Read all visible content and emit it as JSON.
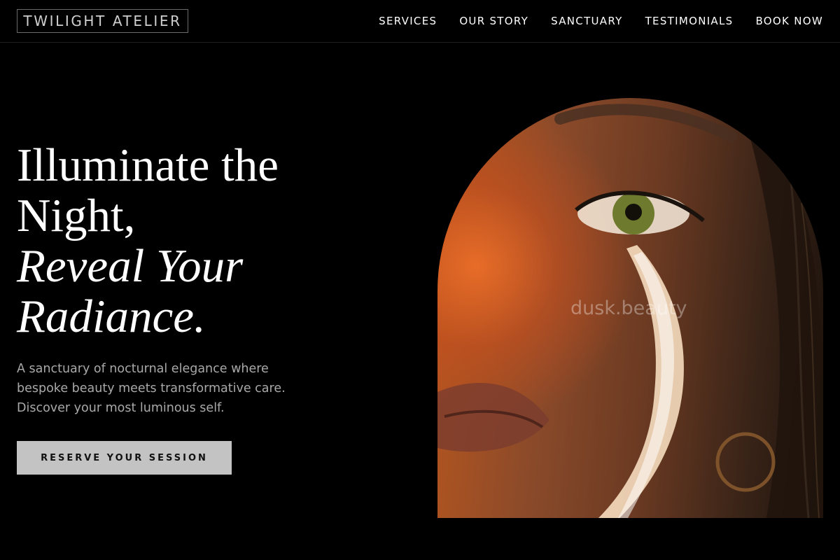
{
  "brand": {
    "name": "TWILIGHT ATELIER"
  },
  "nav": {
    "items": [
      {
        "label": "SERVICES"
      },
      {
        "label": "OUR STORY"
      },
      {
        "label": "SANCTUARY"
      },
      {
        "label": "TESTIMONIALS"
      },
      {
        "label": "BOOK NOW"
      }
    ]
  },
  "hero": {
    "headline_lines": [
      "Illuminate the",
      "Night,"
    ],
    "headline_italic_lines": [
      "Reveal Your",
      "Radiance."
    ],
    "subcopy_lines": [
      "A sanctuary of nocturnal elegance where",
      "bespoke beauty meets transformative care.",
      "Discover your most luminous self."
    ],
    "cta_label": "RESERVE YOUR SESSION",
    "image": {
      "icon": "portrait-image",
      "watermark": "dusk.beauty"
    }
  },
  "colors": {
    "background": "#000000",
    "text": "#ffffff",
    "subcopy": "#a9a9a9",
    "cta_bg": "#c3c3c3",
    "logo_border": "#6b6b6b"
  }
}
